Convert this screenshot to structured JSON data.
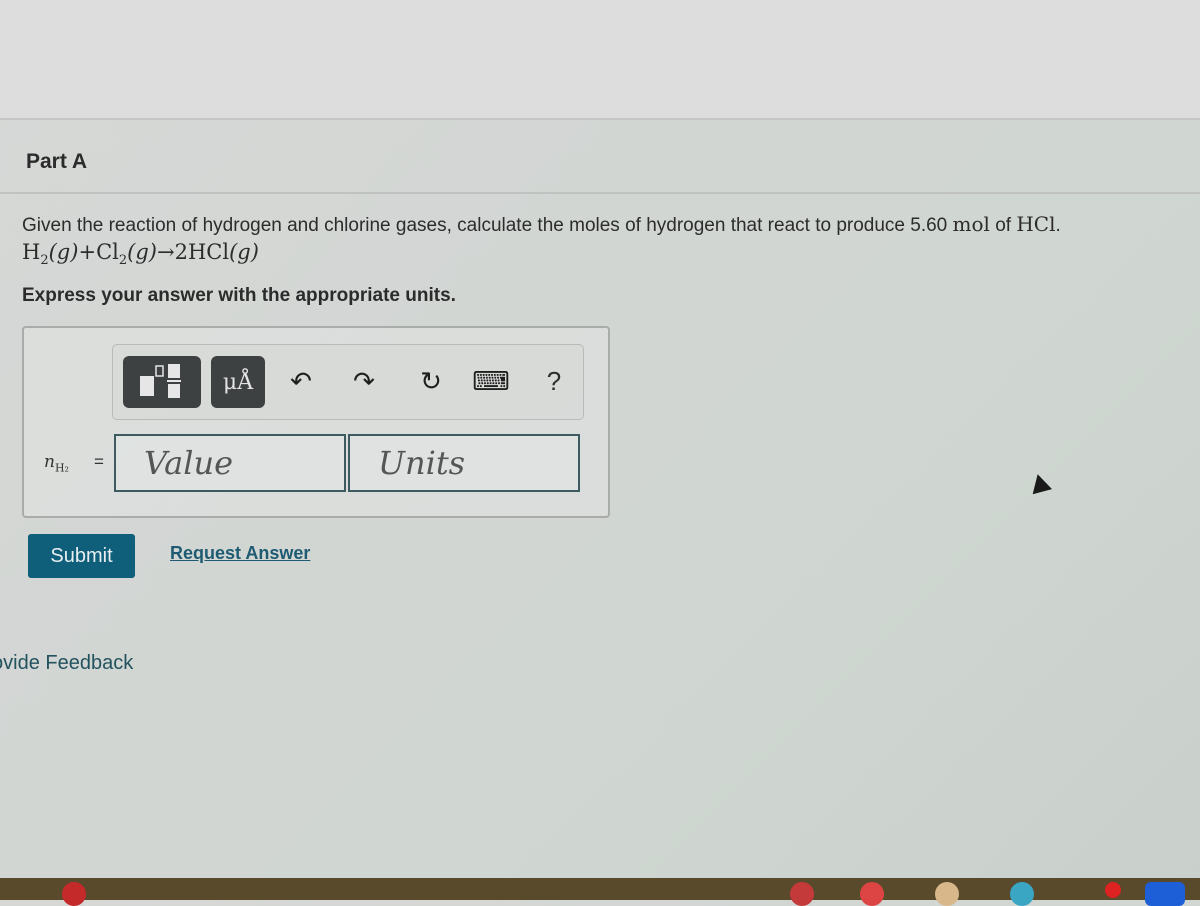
{
  "part": {
    "title": "Part A"
  },
  "question": {
    "text_prefix": "Given the reaction of hydrogen and chlorine gases, calculate the moles of hydrogen that react to produce 5.60 ",
    "unit": "mol",
    "text_mid": " of ",
    "compound": "HCl",
    "text_suffix": "."
  },
  "equation": {
    "r1": "H",
    "r1_sub": "2",
    "r1_state": "(g)",
    "plus": "+",
    "r2": "Cl",
    "r2_sub": "2",
    "r2_state": "(g)",
    "arrow": "→",
    "product": "2HCl",
    "product_state": "(g)"
  },
  "instruction": "Express your answer with the appropriate units.",
  "toolbar": {
    "templates_icon": "templates-icon",
    "units_label": "μÅ",
    "undo_icon": "↶",
    "redo_icon": "↷",
    "reset_icon": "↻",
    "keyboard_icon": "⌨",
    "help_label": "?"
  },
  "answer": {
    "variable": "n",
    "variable_sub": "H₂",
    "equals": "=",
    "value_placeholder": "Value",
    "units_placeholder": "Units"
  },
  "actions": {
    "submit_label": "Submit",
    "request_label": "Request Answer"
  },
  "feedback": {
    "label": "ovide Feedback"
  },
  "colors": {
    "submit_bg": "#0f5f7b",
    "link": "#1e5b73",
    "toolbar_dark": "#3e4142",
    "input_border": "#3c5a60"
  }
}
